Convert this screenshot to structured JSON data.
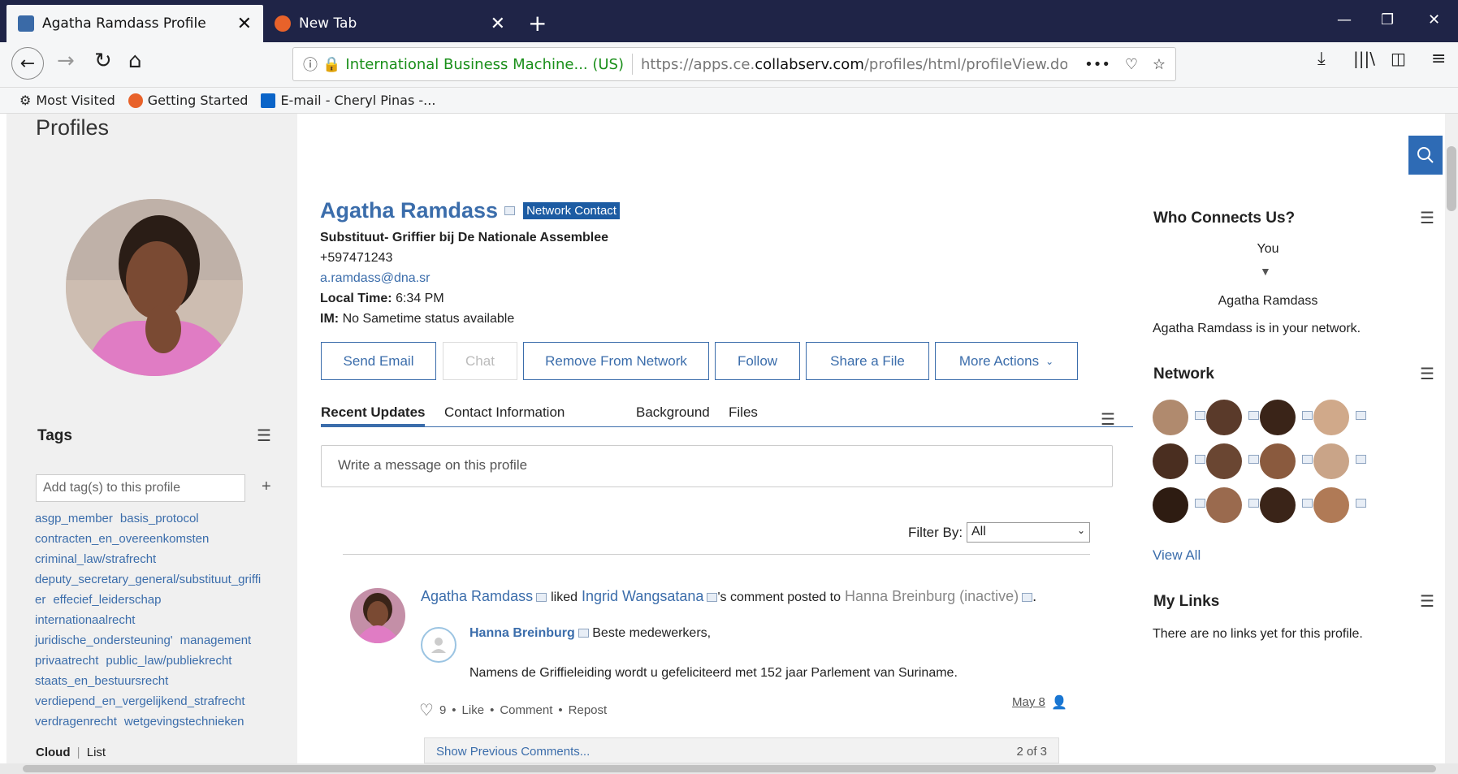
{
  "browser": {
    "tabs": [
      {
        "title": "Agatha Ramdass Profile"
      },
      {
        "title": "New Tab"
      }
    ],
    "url_identity": "International Business Machine... (US)",
    "url_prefix": "https://apps.ce.",
    "url_domain": "collabserv.com",
    "url_path": "/profiles/html/profileView.do",
    "bookmarks": [
      "Most Visited",
      "Getting Started",
      "E-mail - Cheryl Pinas -..."
    ]
  },
  "sidebar": {
    "section_title": "Profiles",
    "tags_title": "Tags",
    "tag_input_placeholder": "Add tag(s) to this profile",
    "tag_lines": [
      [
        "asgp_member",
        "basis_protocol"
      ],
      [
        "contracten_en_overeenkomsten"
      ],
      [
        "criminal_law/strafrecht"
      ],
      [
        "deputy_secretary_general/substituut_griffi"
      ],
      [
        "er",
        "effecief_leiderschap"
      ],
      [
        "internationaalrecht"
      ],
      [
        "juridische_ondersteuning'",
        "management"
      ],
      [
        "privaatrecht",
        "public_law/publiekrecht"
      ],
      [
        "staats_en_bestuursrecht"
      ],
      [
        "verdiepend_en_vergelijkend_strafrecht"
      ],
      [
        "verdragenrecht",
        "wetgevingstechnieken"
      ]
    ],
    "view_cloud": "Cloud",
    "view_list": "List"
  },
  "profile": {
    "name": "Agatha Ramdass",
    "badge": "Network Contact",
    "job_title": "Substituut- Griffier bij De Nationale Assemblee",
    "phone": "+597471243",
    "email": "a.ramdass@dna.sr",
    "local_time_label": "Local Time:",
    "local_time": "6:34 PM",
    "im_label": "IM:",
    "im_status": "No Sametime status available"
  },
  "actions": {
    "send_email": "Send Email",
    "chat": "Chat",
    "remove": "Remove From Network",
    "follow": "Follow",
    "share": "Share a File",
    "more": "More Actions"
  },
  "tabs": [
    "Recent Updates",
    "Contact Information",
    "Background",
    "Files"
  ],
  "message_placeholder": "Write a message on this profile",
  "filter": {
    "label": "Filter By:",
    "value": "All"
  },
  "update": {
    "actor": "Agatha Ramdass",
    "verb": "liked",
    "target": "Ingrid Wangsatana",
    "mid": "'s comment posted to",
    "place": "Hanna Breinburg (inactive)",
    "end": ".",
    "comment_author": "Hanna Breinburg",
    "comment_line1": "Beste medewerkers,",
    "comment_line2": "Namens de Griffieleiding wordt u gefeliciteerd met 152 jaar Parlement van Suriname.",
    "date": "May 8",
    "likes": "9",
    "like": "Like",
    "comment": "Comment",
    "repost": "Repost",
    "show_prev": "Show Previous Comments...",
    "count": "2 of 3"
  },
  "right": {
    "who_title": "Who Connects Us?",
    "you": "You",
    "them": "Agatha Ramdass",
    "in_network": "Agatha Ramdass is in your network.",
    "network_title": "Network",
    "view_all": "View All",
    "links_title": "My Links",
    "no_links": "There are no links yet for this profile."
  },
  "colors": {
    "link": "#3b6dab",
    "badge_bg": "#1d5ca3",
    "tabbar": "#1f2447",
    "search_btn": "#2e6bb5"
  }
}
